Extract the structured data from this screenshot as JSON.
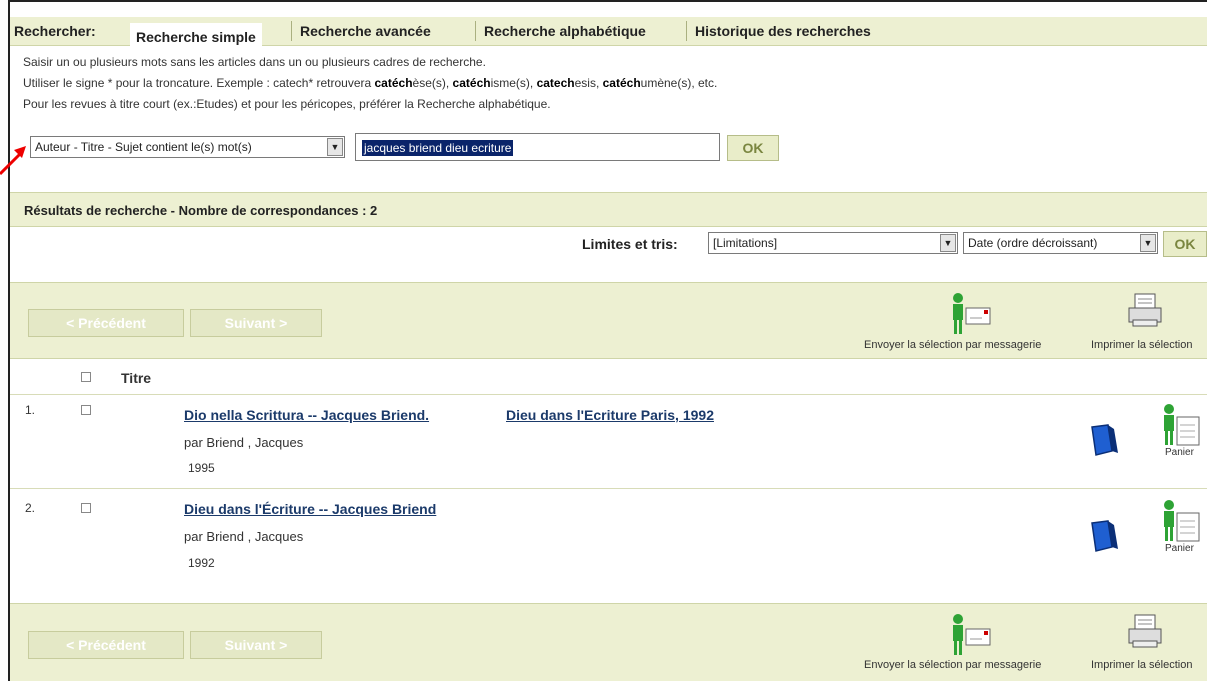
{
  "tabs": {
    "label": "Rechercher:",
    "items": [
      "Recherche simple",
      "Recherche avancée",
      "Recherche alphabétique",
      "Historique des recherches"
    ]
  },
  "help": {
    "line1": "Saisir un ou plusieurs mots sans les articles dans un ou plusieurs cadres de recherche.",
    "line2_a": "Utiliser le signe * pour la troncature. Exemple : catech* retrouvera ",
    "ex1_b": "catéch",
    "ex1_r": "èse(s), ",
    "ex2_b": "catéch",
    "ex2_r": "isme(s), ",
    "ex3_b": "catech",
    "ex3_r": "esis, ",
    "ex4_b": "catéch",
    "ex4_r": "umène(s), etc.",
    "line3": "Pour les revues à titre court (ex.:Etudes) et pour les péricopes, préférer la Recherche alphabétique."
  },
  "search": {
    "field_select": "Auteur - Titre - Sujet contient le(s) mot(s)",
    "query": "jacques briend dieu ecriture",
    "ok_label": "OK"
  },
  "results_header": "Résultats de recherche - Nombre de correspondances : 2",
  "limits": {
    "label": "Limites et tris:",
    "limit_select": "[Limitations]",
    "sort_select": "Date (ordre décroissant)",
    "ok_label": "OK"
  },
  "nav": {
    "prev_label": "< Précédent",
    "next_label": "Suivant >",
    "email_label": "Envoyer la sélection par messagerie",
    "print_label": "Imprimer la sélection"
  },
  "table": {
    "title_header": "Titre"
  },
  "results": [
    {
      "num": "1.",
      "title_a": "Dio nella Scrittura -- Jacques Briend.",
      "title_b": "Dieu dans l'Ecriture Paris, 1992",
      "author": "par Briend , Jacques",
      "year": "1995",
      "panier": "Panier"
    },
    {
      "num": "2.",
      "title_a": "Dieu dans l'Écriture -- Jacques Briend",
      "title_b": "",
      "author": "par Briend , Jacques",
      "year": "1992",
      "panier": "Panier"
    }
  ],
  "colors": {
    "bar_bg": "#edf0d2",
    "link": "#1b3a6a",
    "selection": "#0a246a"
  }
}
